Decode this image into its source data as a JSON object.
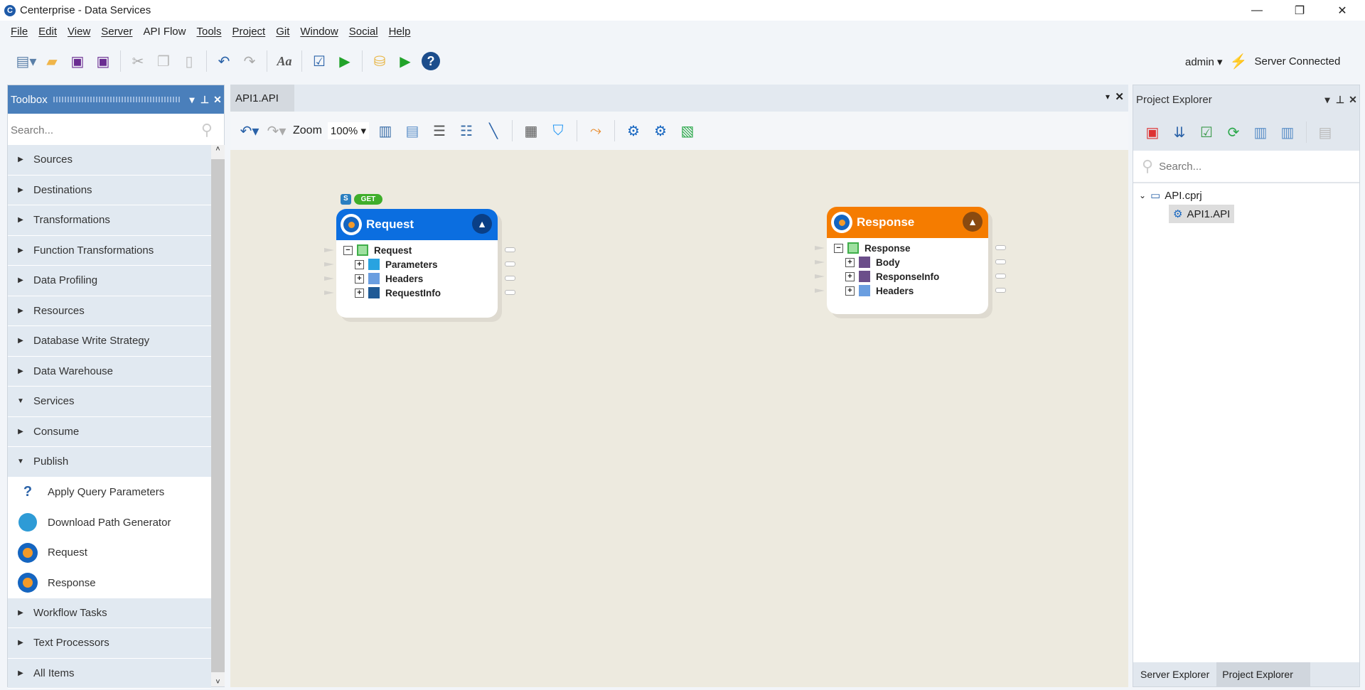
{
  "window": {
    "title": "Centerprise - Data Services"
  },
  "menu": [
    "File",
    "Edit",
    "View",
    "Server",
    "API Flow",
    "Tools",
    "Project",
    "Git",
    "Window",
    "Social",
    "Help"
  ],
  "user": {
    "name": "admin",
    "server_status": "Server Connected"
  },
  "toolbox": {
    "title": "Toolbox",
    "search_placeholder": "Search...",
    "categories_top": [
      "Sources",
      "Destinations",
      "Transformations",
      "Function Transformations",
      "Data Profiling",
      "Resources",
      "Database Write Strategy",
      "Data Warehouse",
      "Services"
    ],
    "subcategories": [
      "Consume",
      "Publish"
    ],
    "publish_items": [
      "Apply Query Parameters",
      "Download Path Generator",
      "Request",
      "Response"
    ],
    "categories_bottom": [
      "Workflow Tasks",
      "Text Processors",
      "All Items"
    ]
  },
  "document": {
    "tab": "API1.API",
    "zoom_label": "Zoom",
    "zoom_value": "100%"
  },
  "canvas": {
    "request": {
      "badge_s": "S",
      "badge_method": "GET",
      "title": "Request",
      "root": "Request",
      "children": [
        "Parameters",
        "Headers",
        "RequestInfo"
      ],
      "color": "#0b6ee0"
    },
    "response": {
      "title": "Response",
      "root": "Response",
      "children": [
        "Body",
        "ResponseInfo",
        "Headers"
      ],
      "color": "#f57c00"
    }
  },
  "project_explorer": {
    "title": "Project Explorer",
    "search_placeholder": "Search...",
    "project": "API.cprj",
    "file": "API1.API"
  },
  "bottom_tabs": [
    "Server Explorer",
    "Project Explorer"
  ]
}
